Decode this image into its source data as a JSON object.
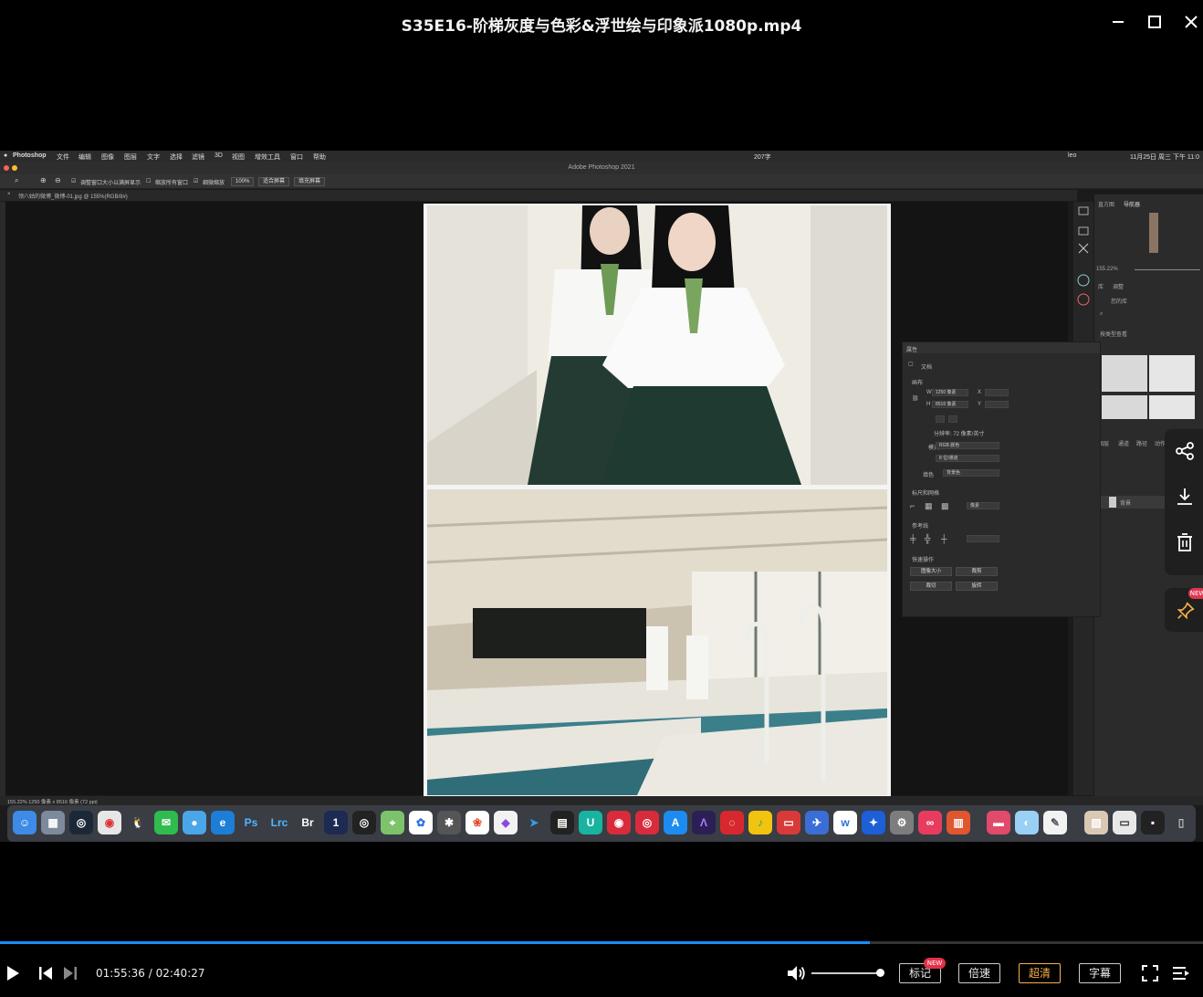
{
  "player": {
    "title": "S35E16-阶梯灰度与色彩&浮世绘与印象派1080p.mp4",
    "current_time": "01:55:36",
    "time_separator": "/",
    "total_time": "02:40:27",
    "progress_fraction": 0.723,
    "volume_fraction": 0.95,
    "buttons": {
      "mark": "标记",
      "mark_badge": "NEW",
      "speed": "倍速",
      "quality": "超清",
      "subtitle": "字幕"
    },
    "side_new_badge": "NEW"
  },
  "mac_menubar": {
    "app": "Photoshop",
    "menus": [
      "文件",
      "编辑",
      "图像",
      "图层",
      "文字",
      "选择",
      "滤镜",
      "3D",
      "视图",
      "增效工具",
      "窗口",
      "帮助"
    ],
    "status_left": "207字",
    "status_right": "11月25日 周三 下午 11:0",
    "user": "leo"
  },
  "photoshop": {
    "window_title": "Adobe Photoshop 2021",
    "options": {
      "resize_windows": "调整窗口大小以满屏显示",
      "zoom_all": "缩放所有窗口",
      "scrubby_zoom": "细微缩放",
      "zoom_value": "100%",
      "fit_screen": "适合屏幕",
      "fill_screen": "填充屏幕"
    },
    "doc_tab": "领八姑的微博_微博-01.jpg @ 155%(RGB/8#)",
    "status": "155.22%   1250 像素 x 8516 像素 (72 ppi)",
    "nav": {
      "tabs": [
        "直方图",
        "导航器"
      ],
      "zoom": "155.22%",
      "lib_tabs": [
        "库",
        "调整"
      ],
      "lib_title": "您的库",
      "search_placeholder": "按类型查看"
    },
    "layers": {
      "tabs": [
        "图层",
        "通道",
        "路径",
        "动作"
      ],
      "layer_name": "背景"
    },
    "properties": {
      "title": "属性",
      "doc_label": "文档",
      "canvas_section": "画布",
      "w_label": "W",
      "w_value": "1250 像素",
      "h_label": "H",
      "h_value": "8516 像素",
      "x_label": "X",
      "y_label": "Y",
      "resolution": "分辨率: 72 像素/英寸",
      "mode_label": "模式",
      "mode_value": "RGB 颜色",
      "depth_value": "8 位/通道",
      "fill_label": "填色",
      "fill_value": "背景色",
      "rulers_section": "标尺和网格",
      "ruler_unit": "像素",
      "guides_section": "参考线",
      "quick_section": "快速操作",
      "quick_buttons": [
        "图像大小",
        "裁剪",
        "裁切",
        "旋转"
      ]
    }
  },
  "dock_apps": [
    "Finder",
    "Launchpad",
    "Steam",
    "Chrome",
    "QQ",
    "WeChat",
    "Bird",
    "Edge",
    "Ps",
    "Lrc",
    "Br",
    "1Password",
    "Aperture",
    "Maps",
    "Baidu",
    "Pinwheel",
    "Photos",
    "Vectorize",
    "Arrow",
    "Final Cut",
    "Upwork",
    "Podcast",
    "Cast",
    "App Store",
    "Affinity",
    "NetEase",
    "QQ Music",
    "Radio",
    "Feather",
    "Wunderlist",
    "Copilot",
    "Prefs",
    "Creative Cloud",
    "Grid",
    "Books",
    "Palette",
    "Notes",
    "Preview",
    "Monitor",
    "Pad",
    "Trash"
  ]
}
